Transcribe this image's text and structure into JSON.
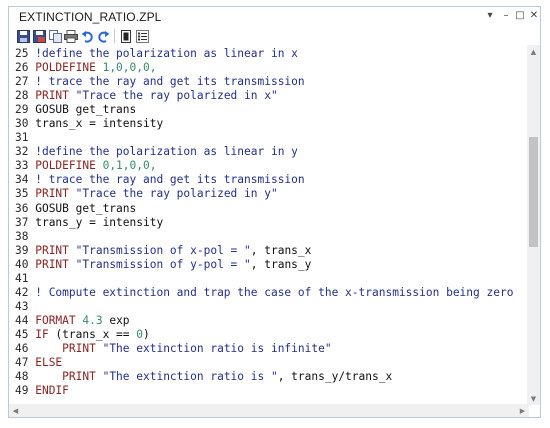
{
  "window": {
    "title": "EXTINCTION_RATIO.ZPL"
  },
  "controls": {
    "dropdown": "▾",
    "minimize": "–",
    "maximize": "□",
    "close": "✕"
  },
  "toolbar": {
    "icons": [
      "save-icon",
      "save-as-icon",
      "copy-icon",
      "print-icon",
      "undo-icon",
      "redo-icon",
      "run-icon",
      "list-icon"
    ]
  },
  "editor": {
    "lines": [
      [
        {
          "t": "25 ",
          "c": "ln"
        },
        {
          "t": "!define the polarization as linear in x",
          "c": "cmt"
        }
      ],
      [
        {
          "t": "26 ",
          "c": "ln"
        },
        {
          "t": "POLDEFINE ",
          "c": "kw"
        },
        {
          "t": "1,0,0,0,",
          "c": "num"
        }
      ],
      [
        {
          "t": "27 ",
          "c": "ln"
        },
        {
          "t": "! trace the ray and get its transmission",
          "c": "cmt"
        }
      ],
      [
        {
          "t": "28 ",
          "c": "ln"
        },
        {
          "t": "PRINT ",
          "c": "kw"
        },
        {
          "t": "\"Trace the ray polarized in x\"",
          "c": "str"
        }
      ],
      [
        {
          "t": "29 ",
          "c": "ln"
        },
        {
          "t": "GOSUB get_trans",
          "c": "plain"
        }
      ],
      [
        {
          "t": "30 ",
          "c": "ln"
        },
        {
          "t": "trans_x = intensity",
          "c": "plain"
        }
      ],
      [
        {
          "t": "31",
          "c": "ln"
        }
      ],
      [
        {
          "t": "32 ",
          "c": "ln"
        },
        {
          "t": "!define the polarization as linear in y",
          "c": "cmt"
        }
      ],
      [
        {
          "t": "33 ",
          "c": "ln"
        },
        {
          "t": "POLDEFINE ",
          "c": "kw"
        },
        {
          "t": "0,1,0,0,",
          "c": "num"
        }
      ],
      [
        {
          "t": "34 ",
          "c": "ln"
        },
        {
          "t": "! trace the ray and get its transmission",
          "c": "cmt"
        }
      ],
      [
        {
          "t": "35 ",
          "c": "ln"
        },
        {
          "t": "PRINT ",
          "c": "kw"
        },
        {
          "t": "\"Trace the ray polarized in y\"",
          "c": "str"
        }
      ],
      [
        {
          "t": "36 ",
          "c": "ln"
        },
        {
          "t": "GOSUB get_trans",
          "c": "plain"
        }
      ],
      [
        {
          "t": "37 ",
          "c": "ln"
        },
        {
          "t": "trans_y = intensity",
          "c": "plain"
        }
      ],
      [
        {
          "t": "38",
          "c": "ln"
        }
      ],
      [
        {
          "t": "39 ",
          "c": "ln"
        },
        {
          "t": "PRINT ",
          "c": "kw"
        },
        {
          "t": "\"Transmission of x-pol = \"",
          "c": "str"
        },
        {
          "t": ", trans_x",
          "c": "plain"
        }
      ],
      [
        {
          "t": "40 ",
          "c": "ln"
        },
        {
          "t": "PRINT ",
          "c": "kw"
        },
        {
          "t": "\"Transmission of y-pol = \"",
          "c": "str"
        },
        {
          "t": ", trans_y",
          "c": "plain"
        }
      ],
      [
        {
          "t": "41",
          "c": "ln"
        }
      ],
      [
        {
          "t": "42 ",
          "c": "ln"
        },
        {
          "t": "! Compute extinction and trap the case of the x-transmission being zero",
          "c": "cmt"
        }
      ],
      [
        {
          "t": "43",
          "c": "ln"
        }
      ],
      [
        {
          "t": "44 ",
          "c": "ln"
        },
        {
          "t": "FORMAT ",
          "c": "kw"
        },
        {
          "t": "4.3 ",
          "c": "num"
        },
        {
          "t": "exp",
          "c": "plain"
        }
      ],
      [
        {
          "t": "45 ",
          "c": "ln"
        },
        {
          "t": "IF ",
          "c": "kw"
        },
        {
          "t": "(trans_x == ",
          "c": "plain"
        },
        {
          "t": "0",
          "c": "num"
        },
        {
          "t": ")",
          "c": "plain"
        }
      ],
      [
        {
          "t": "46 ",
          "c": "ln"
        },
        {
          "t": "    PRINT ",
          "c": "kw"
        },
        {
          "t": "\"The extinction ratio is infinite\"",
          "c": "str"
        }
      ],
      [
        {
          "t": "47 ",
          "c": "ln"
        },
        {
          "t": "ELSE",
          "c": "kw"
        }
      ],
      [
        {
          "t": "48 ",
          "c": "ln"
        },
        {
          "t": "    PRINT ",
          "c": "kw"
        },
        {
          "t": "\"The extinction ratio is \"",
          "c": "str"
        },
        {
          "t": ", trans_y/trans_x",
          "c": "plain"
        }
      ],
      [
        {
          "t": "49 ",
          "c": "ln"
        },
        {
          "t": "ENDIF",
          "c": "kw"
        }
      ]
    ]
  },
  "scrollbars": {
    "up": "▲",
    "down": "▼",
    "left": "◀",
    "right": "▶"
  },
  "colors": {
    "keyword": "#8a2323",
    "number": "#3a8a6a",
    "string": "#232f8a",
    "comment": "#232f8a",
    "border": "#b9c9da"
  }
}
